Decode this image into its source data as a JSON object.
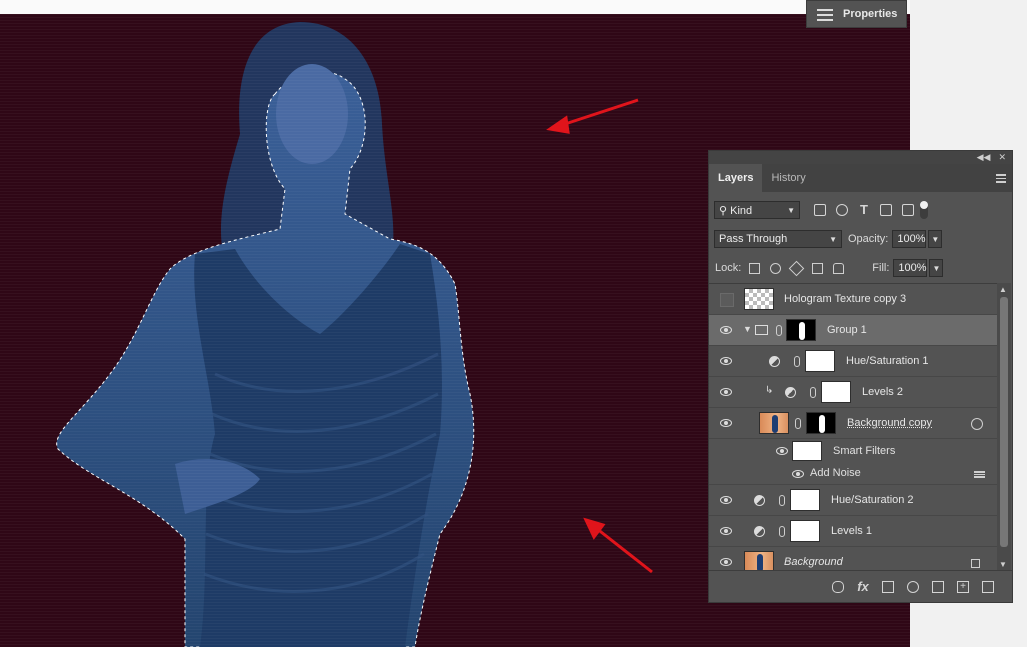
{
  "properties_panel": {
    "label": "Properties",
    "icon": "sliders-icon"
  },
  "layers_panel": {
    "tabs": [
      {
        "label": "Layers",
        "active": true
      },
      {
        "label": "History",
        "active": false
      }
    ],
    "header_controls": [
      "collapse-icon",
      "close-icon"
    ],
    "filter": {
      "kind_label": "Kind",
      "icons": [
        "image-filter-icon",
        "adjustment-filter-icon",
        "type-filter-icon",
        "shape-filter-icon",
        "smart-object-filter-icon"
      ]
    },
    "blend_mode": "Pass Through",
    "opacity": {
      "label": "Opacity:",
      "value": "100%"
    },
    "lock": {
      "label": "Lock:",
      "icons": [
        "lock-transparent-icon",
        "lock-pixels-icon",
        "lock-position-icon",
        "lock-artboard-icon",
        "lock-all-icon"
      ]
    },
    "fill": {
      "label": "Fill:",
      "value": "100%"
    },
    "layers": [
      {
        "name": "Hologram Texture copy 3",
        "visible": false,
        "thumb": "checker"
      },
      {
        "name": "Group 1",
        "visible": true,
        "type": "group",
        "selected": true
      },
      {
        "name": "Hue/Saturation 1",
        "visible": true,
        "type": "adjustment"
      },
      {
        "name": "Levels 2",
        "visible": true,
        "type": "adjustment",
        "clipped": true
      },
      {
        "name": "Background copy",
        "visible": true,
        "type": "smart-object"
      },
      {
        "name": "Smart Filters",
        "visible": true,
        "type": "smart-filters"
      },
      {
        "name": "Add Noise",
        "visible": true,
        "type": "filter"
      },
      {
        "name": "Hue/Saturation 2",
        "visible": true,
        "type": "adjustment"
      },
      {
        "name": "Levels 1",
        "visible": true,
        "type": "adjustment"
      },
      {
        "name": "Background",
        "visible": true,
        "type": "background",
        "locked": true
      }
    ],
    "bottom_icons": [
      "link-layers-icon",
      "fx-icon",
      "add-mask-icon",
      "new-adjustment-icon",
      "new-group-icon",
      "new-layer-icon",
      "delete-icon"
    ],
    "fx_label": "fx"
  },
  "colors": {
    "canvas_bg": "#2f0716",
    "figure": "#2c4f85",
    "panel": "#535353",
    "arrow": "#e0141b"
  }
}
